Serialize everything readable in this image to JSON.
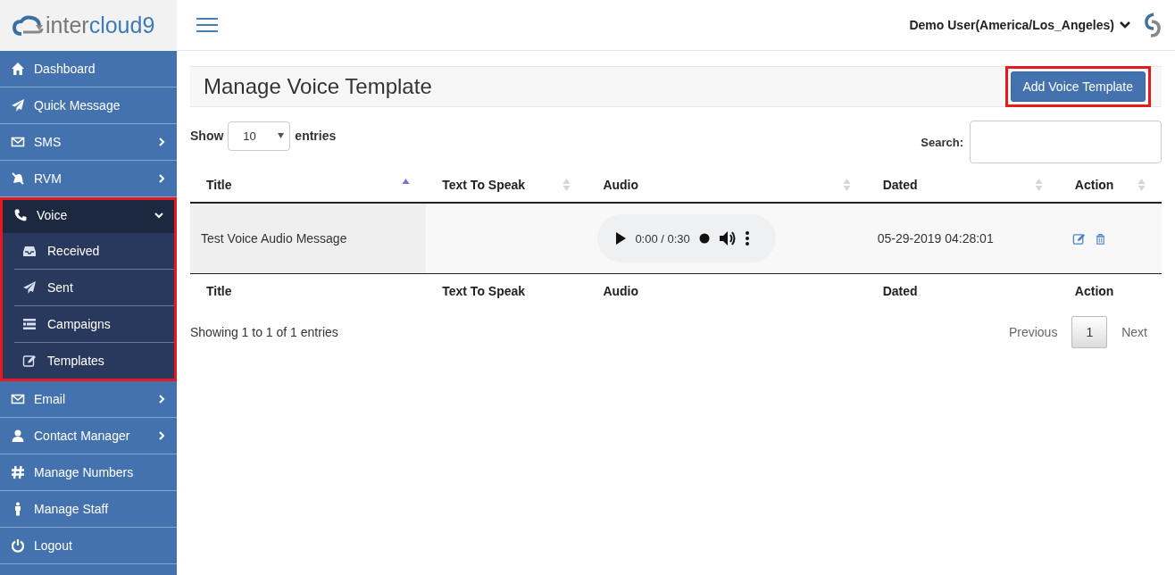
{
  "logo": {
    "prefix": "inter",
    "suffix": "cloud9"
  },
  "header": {
    "user": "Demo User(America/Los_Angeles)"
  },
  "sidebar": {
    "items": [
      {
        "label": "Dashboard",
        "kind": "home",
        "has_submenu": false,
        "expanded": false,
        "highlighted": false
      },
      {
        "label": "Quick Message",
        "kind": "send",
        "has_submenu": false,
        "expanded": false,
        "highlighted": false
      },
      {
        "label": "SMS",
        "kind": "mail",
        "has_submenu": true,
        "expanded": false,
        "highlighted": false
      },
      {
        "label": "RVM",
        "kind": "mute",
        "has_submenu": true,
        "expanded": false,
        "highlighted": false
      },
      {
        "label": "Voice",
        "kind": "phone",
        "has_submenu": true,
        "expanded": true,
        "highlighted": true,
        "children": [
          {
            "label": "Received",
            "kind": "inbox"
          },
          {
            "label": "Sent",
            "kind": "send"
          },
          {
            "label": "Campaigns",
            "kind": "list"
          },
          {
            "label": "Templates",
            "kind": "edit"
          }
        ]
      },
      {
        "label": "Email",
        "kind": "mail",
        "has_submenu": true,
        "expanded": false,
        "highlighted": false
      },
      {
        "label": "Contact Manager",
        "kind": "user",
        "has_submenu": true,
        "expanded": false,
        "highlighted": false
      },
      {
        "label": "Manage Numbers",
        "kind": "hash",
        "has_submenu": false,
        "expanded": false,
        "highlighted": false
      },
      {
        "label": "Manage Staff",
        "kind": "person",
        "has_submenu": false,
        "expanded": false,
        "highlighted": false
      },
      {
        "label": "Logout",
        "kind": "power",
        "has_submenu": false,
        "expanded": false,
        "highlighted": false
      }
    ]
  },
  "page": {
    "title": "Manage Voice Template",
    "add_button": {
      "label": "Add Voice Template",
      "highlighted": true
    }
  },
  "length": {
    "prefix": "Show",
    "value": "10",
    "suffix": "entries"
  },
  "search": {
    "label": "Search:"
  },
  "table": {
    "columns": [
      {
        "label": "Title",
        "sorted": true
      },
      {
        "label": "Text To Speak",
        "sorted": false
      },
      {
        "label": "Audio",
        "sorted": false
      },
      {
        "label": "Dated",
        "sorted": false
      },
      {
        "label": "Action",
        "sorted": false
      }
    ],
    "rows": [
      {
        "title": "Test Voice Audio Message",
        "audio": {
          "time": "0:00 / 0:30"
        },
        "dated": "05-29-2019 04:28:01"
      }
    ],
    "footer": [
      "Title",
      "Text To Speak",
      "Audio",
      "Dated",
      "Action"
    ]
  },
  "info": "Showing 1 to 1 of 1 entries",
  "pagination": {
    "previous": "Previous",
    "pages": [
      {
        "label": "1",
        "selected": true
      }
    ],
    "next": "Next"
  }
}
